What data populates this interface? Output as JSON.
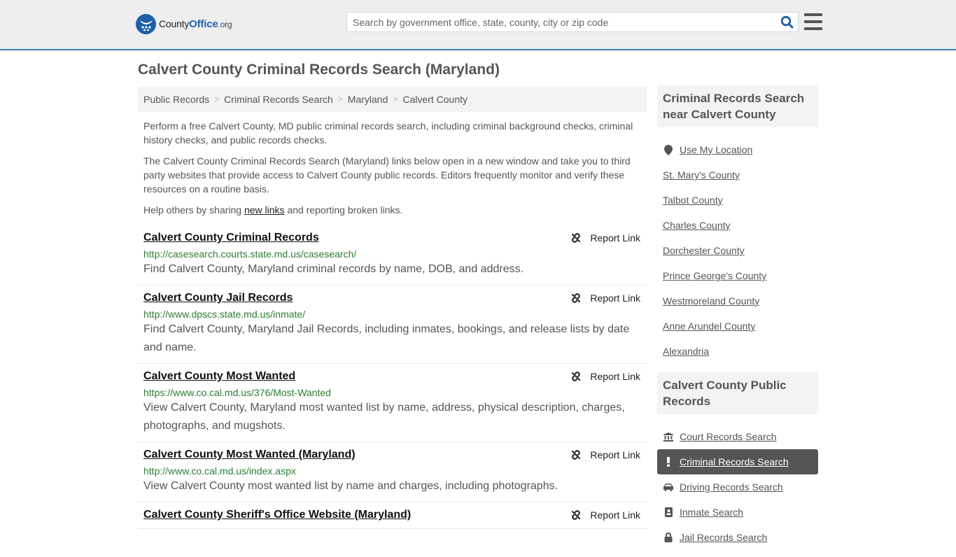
{
  "header": {
    "logo": {
      "name": "County",
      "brand": "Office",
      "tld": ".org"
    },
    "search_placeholder": "Search by government office, state, county, city or zip code",
    "search_value": ""
  },
  "page": {
    "title": "Calvert County Criminal Records Search (Maryland)"
  },
  "breadcrumb": [
    {
      "label": "Public Records"
    },
    {
      "label": "Criminal Records Search"
    },
    {
      "label": "Maryland"
    },
    {
      "label": "Calvert County"
    }
  ],
  "intro": {
    "p1": "Perform a free Calvert County, MD public criminal records search, including criminal background checks, criminal history checks, and public records checks.",
    "p2": "The Calvert County Criminal Records Search (Maryland) links below open in a new window and take you to third party websites that provide access to Calvert County public records. Editors frequently monitor and verify these resources on a routine basis.",
    "p3_before": "Help others by sharing ",
    "p3_link": "new links",
    "p3_after": " and reporting broken links."
  },
  "report_label": "Report Link",
  "results": [
    {
      "title": "Calvert County Criminal Records",
      "url": "http://casesearch.courts.state.md.us/casesearch/",
      "desc": "Find Calvert County, Maryland criminal records by name, DOB, and address."
    },
    {
      "title": "Calvert County Jail Records",
      "url": "http://www.dpscs.state.md.us/inmate/",
      "desc": "Find Calvert County, Maryland Jail Records, including inmates, bookings, and release lists by date and name."
    },
    {
      "title": "Calvert County Most Wanted",
      "url": "https://www.co.cal.md.us/376/Most-Wanted",
      "desc": "View Calvert County, Maryland most wanted list by name, address, physical description, charges, photographs, and mugshots."
    },
    {
      "title": "Calvert County Most Wanted (Maryland)",
      "url": "http://www.co.cal.md.us/index.aspx",
      "desc": "View Calvert County most wanted list by name and charges, including photographs."
    },
    {
      "title": "Calvert County Sheriff's Office Website (Maryland)",
      "url": "",
      "desc": ""
    }
  ],
  "sidebar": {
    "nearby": {
      "heading": "Criminal Records Search near Calvert County",
      "use_location": "Use My Location",
      "items": [
        "St. Mary's County",
        "Talbot County",
        "Charles County",
        "Dorchester County",
        "Prince George's County",
        "Westmoreland County",
        "Anne Arundel County",
        "Alexandria"
      ]
    },
    "public_records": {
      "heading": "Calvert County Public Records",
      "items": [
        {
          "label": "Court Records Search",
          "icon": "courthouse-icon",
          "active": false
        },
        {
          "label": "Criminal Records Search",
          "icon": "exclamation-icon",
          "active": true
        },
        {
          "label": "Driving Records Search",
          "icon": "car-icon",
          "active": false
        },
        {
          "label": "Inmate Search",
          "icon": "id-badge-icon",
          "active": false
        },
        {
          "label": "Jail Records Search",
          "icon": "lock-icon",
          "active": false
        }
      ]
    }
  },
  "colors": {
    "accent": "#3b78b0",
    "brand": "#1d64b0",
    "url_green": "#2e7d32",
    "active_bg": "#555555"
  }
}
